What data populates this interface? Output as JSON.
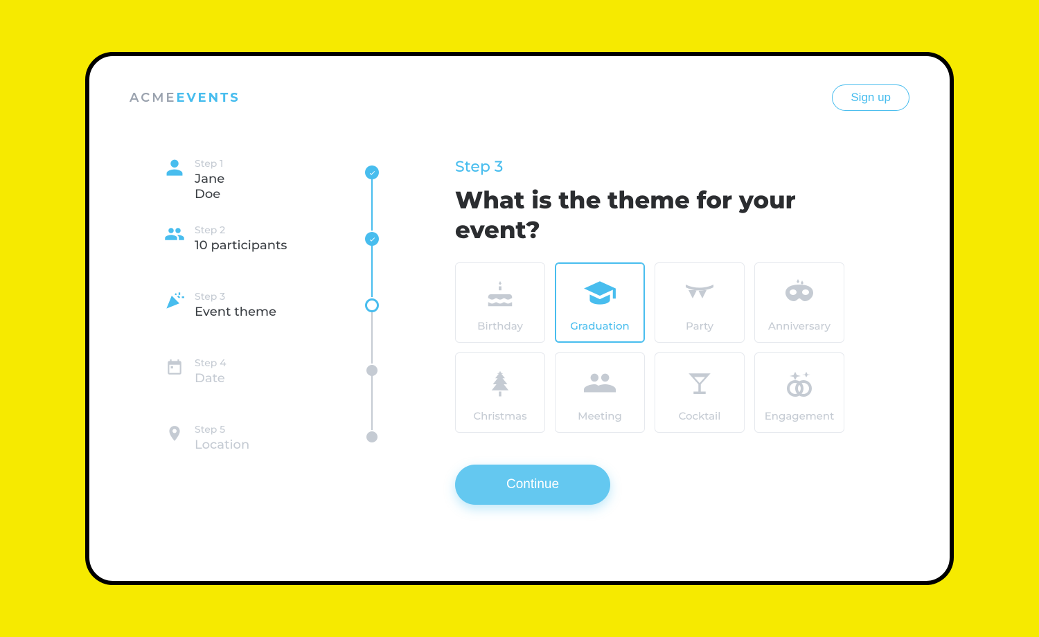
{
  "brand": {
    "part1": "ACME",
    "part2": "EVENTS"
  },
  "header": {
    "signup": "Sign up"
  },
  "sidebar": {
    "steps": [
      {
        "label": "Step 1",
        "value": "Jane\nDoe",
        "state": "done",
        "icon": "user"
      },
      {
        "label": "Step 2",
        "value": "10 participants",
        "state": "done",
        "icon": "users"
      },
      {
        "label": "Step 3",
        "value": "Event theme",
        "state": "current",
        "icon": "confetti"
      },
      {
        "label": "Step 4",
        "value": "Date",
        "state": "future",
        "icon": "calendar"
      },
      {
        "label": "Step 5",
        "value": "Location",
        "state": "future",
        "icon": "pin"
      }
    ]
  },
  "main": {
    "step_tag": "Step 3",
    "question": "What is the theme for your event?",
    "options": [
      {
        "label": "Birthday",
        "icon": "cake",
        "selected": false
      },
      {
        "label": "Graduation",
        "icon": "gradcap",
        "selected": true
      },
      {
        "label": "Party",
        "icon": "bunting",
        "selected": false
      },
      {
        "label": "Anniversary",
        "icon": "mask",
        "selected": false
      },
      {
        "label": "Christmas",
        "icon": "tree",
        "selected": false
      },
      {
        "label": "Meeting",
        "icon": "group",
        "selected": false
      },
      {
        "label": "Cocktail",
        "icon": "martini",
        "selected": false
      },
      {
        "label": "Engagement",
        "icon": "rings",
        "selected": false
      }
    ],
    "continue": "Continue"
  }
}
